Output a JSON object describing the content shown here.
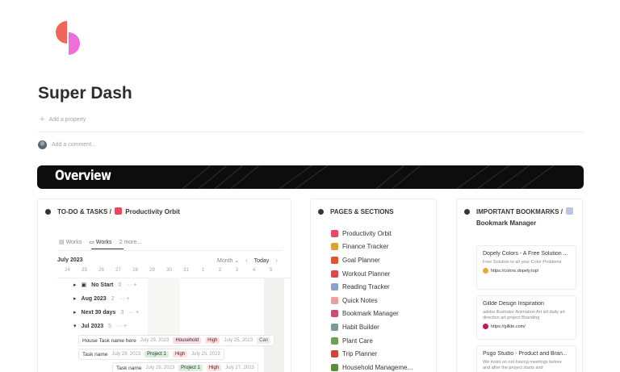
{
  "page": {
    "title": "Super Dash",
    "add_property": "Add a property",
    "add_comment": "Add a comment..."
  },
  "banner": {
    "title": "Overview"
  },
  "todo": {
    "heading_prefix": "TO-DO & TASKS /",
    "heading_link": "Productivity Orbit",
    "views": [
      "Works",
      "Works",
      "2 more..."
    ],
    "month": "July 2023",
    "month_selector": "Month",
    "today": "Today",
    "days": [
      "24",
      "25",
      "26",
      "27",
      "28",
      "29",
      "30",
      "31",
      "1",
      "2",
      "3",
      "4",
      "5"
    ],
    "groups": [
      {
        "label": "No Start",
        "count": "0"
      },
      {
        "label": "Aug 2023",
        "count": "2"
      },
      {
        "label": "Next 30 days",
        "count": "3"
      },
      {
        "label": "Jul 2023",
        "count": "5"
      }
    ],
    "tasks": [
      {
        "name": "House Task name here",
        "start": "July 29, 2023",
        "tag1": "Household",
        "tag2": "High",
        "end": "July 25, 2023",
        "extra": "Can"
      },
      {
        "name": "Task name",
        "start": "July 29, 2023",
        "tag1": "Project 1",
        "tag2": "High",
        "end": "July 25, 2023"
      },
      {
        "name": "Task name",
        "start": "July 29, 2023",
        "tag1": "Project 1",
        "tag2": "High",
        "end": "July 27, 2023"
      }
    ]
  },
  "pages": {
    "heading": "PAGES & SECTIONS",
    "items": [
      {
        "label": "Productivity Orbit",
        "color": "#e8475f"
      },
      {
        "label": "Finance Tracker",
        "color": "#d8a530"
      },
      {
        "label": "Goal Planner",
        "color": "#e0532e"
      },
      {
        "label": "Workout Planner",
        "color": "#d94a4a"
      },
      {
        "label": "Reading Tracker",
        "color": "#8aa4c8"
      },
      {
        "label": "Quick Notes",
        "color": "#e9a0a0"
      },
      {
        "label": "Bookmark Manager",
        "color": "#c94f6d"
      },
      {
        "label": "Habit Builder",
        "color": "#7a9a9a"
      },
      {
        "label": "Plant Care",
        "color": "#6ea04f"
      },
      {
        "label": "Trip Planner",
        "color": "#d0453b"
      },
      {
        "label": "Household Manageme...",
        "color": "#5c8a3a"
      }
    ]
  },
  "bookmarks": {
    "heading_prefix": "IMPORTANT BOOKMARKS /",
    "heading_link": "Bookmark Manager",
    "items": [
      {
        "title": "Dopely Colors - A Free Solution ...",
        "desc": "Free Solution to all your Color Problems",
        "url": "https://colors.dopely.top/",
        "color": "#f2a33a"
      },
      {
        "title": "Gillde Design Inspiration",
        "desc": "adobe illustrator Animation Art art daily art direction art project Branding",
        "url": "https://gillde.com/",
        "color": "#c2185b"
      },
      {
        "title": "Pugo Studio - Product and Bran...",
        "desc": "We insist on not having meetings before and after the project starts and",
        "url": "",
        "color": "#444"
      }
    ]
  },
  "colors": {
    "logo_top": "#f2655a",
    "logo_bottom": "#ee6fd8"
  }
}
